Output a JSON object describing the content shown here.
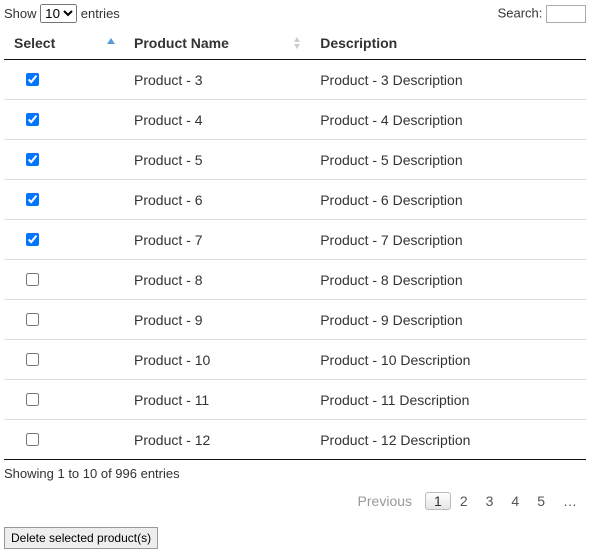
{
  "length": {
    "prefix": "Show",
    "value": "10",
    "options": [
      "10"
    ],
    "suffix": "entries"
  },
  "search": {
    "label": "Search:",
    "value": ""
  },
  "columns": {
    "select": "Select",
    "name": "Product Name",
    "desc": "Description"
  },
  "rows": [
    {
      "checked": true,
      "name": "Product - 3",
      "desc": "Product - 3 Description"
    },
    {
      "checked": true,
      "name": "Product - 4",
      "desc": "Product - 4 Description"
    },
    {
      "checked": true,
      "name": "Product - 5",
      "desc": "Product - 5 Description"
    },
    {
      "checked": true,
      "name": "Product - 6",
      "desc": "Product - 6 Description"
    },
    {
      "checked": true,
      "name": "Product - 7",
      "desc": "Product - 7 Description"
    },
    {
      "checked": false,
      "name": "Product - 8",
      "desc": "Product - 8 Description"
    },
    {
      "checked": false,
      "name": "Product - 9",
      "desc": "Product - 9 Description"
    },
    {
      "checked": false,
      "name": "Product - 10",
      "desc": "Product - 10 Description"
    },
    {
      "checked": false,
      "name": "Product - 11",
      "desc": "Product - 11 Description"
    },
    {
      "checked": false,
      "name": "Product - 12",
      "desc": "Product - 12 Description"
    }
  ],
  "info": "Showing 1 to 10 of 996 entries",
  "pagination": {
    "previous": "Previous",
    "pages": [
      "1",
      "2",
      "3",
      "4",
      "5",
      "…"
    ],
    "current": "1"
  },
  "actions": {
    "delete_label": "Delete selected product(s)"
  }
}
